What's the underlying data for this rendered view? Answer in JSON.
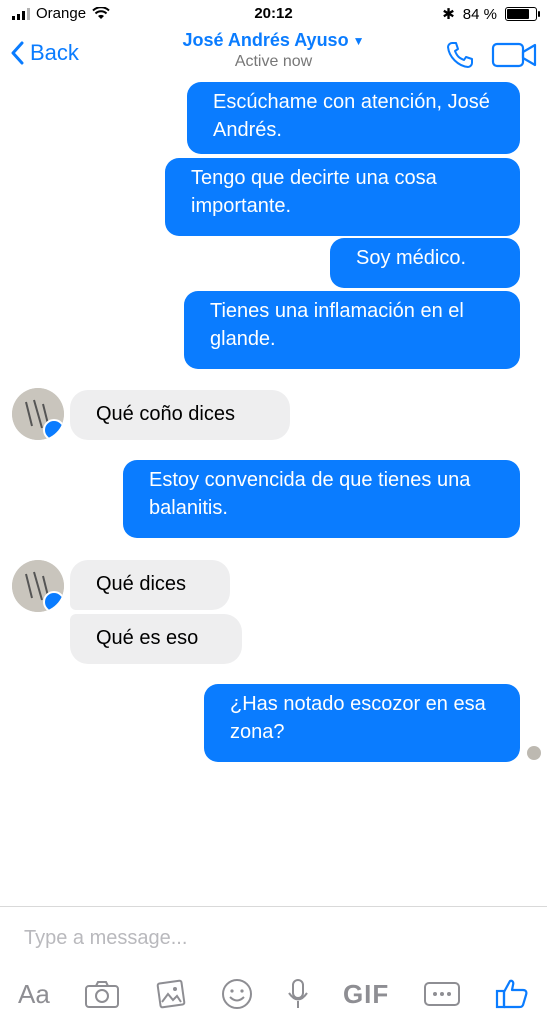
{
  "status_bar": {
    "carrier": "Orange",
    "time": "20:12",
    "battery": "84 %",
    "battery_level": 0.84
  },
  "header": {
    "back_label": "Back",
    "contact_name": "José Andrés Ayuso",
    "status": "Active now"
  },
  "messages": [
    {
      "dir": "out",
      "text": "Escúchame con atención, José Andrés."
    },
    {
      "dir": "out",
      "text": "Tengo que decirte una cosa importante."
    },
    {
      "dir": "out",
      "text": "Soy médico."
    },
    {
      "dir": "out",
      "text": "Tienes una inflamación en el glande."
    },
    {
      "dir": "in",
      "text": "Qué coño dices"
    },
    {
      "dir": "out",
      "text": "Estoy convencida de que tienes una balanitis."
    },
    {
      "dir": "in",
      "text": "Qué dices"
    },
    {
      "dir": "in",
      "text": "Qué es eso"
    },
    {
      "dir": "out",
      "text": "¿Has notado escozor en esa zona?"
    }
  ],
  "composer": {
    "placeholder": "Type a message...",
    "toolbar": {
      "text_button": "Aa",
      "gif_button": "GIF"
    }
  },
  "colors": {
    "accent": "#0a7cff",
    "incoming_bubble": "#eeeeef"
  }
}
